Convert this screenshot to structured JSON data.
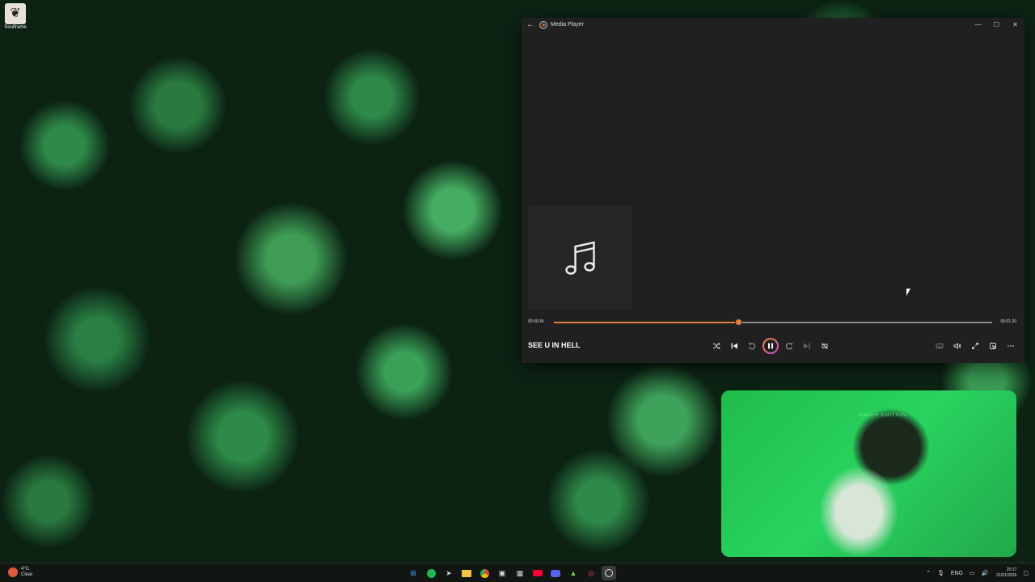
{
  "desktop": {
    "icon_label": "Soulframe"
  },
  "window": {
    "title": "Media Player",
    "back": "←",
    "minimize": "—",
    "maximize": "☐",
    "close": "✕"
  },
  "player": {
    "current_time": "00:00:34",
    "duration": "00:01:20",
    "progress": 0.42,
    "song_title": "SEE U IN HELL"
  },
  "webcam": {
    "caption": "RAZER EDITION"
  },
  "taskbar": {
    "temperature": "4°C",
    "condition": "Clear",
    "language": "ENG",
    "time": "20:17",
    "date": "01/01/2026"
  },
  "colors": {
    "accent": "#e2813f",
    "window_bg": "#202020"
  }
}
